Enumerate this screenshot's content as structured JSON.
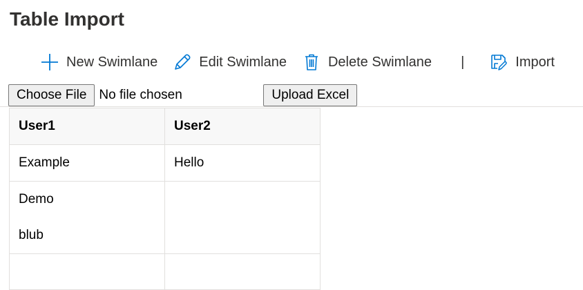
{
  "page": {
    "title": "Table Import"
  },
  "toolbar": {
    "new_label": "New Swimlane",
    "edit_label": "Edit Swimlane",
    "delete_label": "Delete Swimlane",
    "separator": "|",
    "import_label": "Import",
    "icons": [
      "plus-icon",
      "pencil-icon",
      "trash-icon",
      "save-icon"
    ],
    "accent_color": "#0078d4"
  },
  "file_input": {
    "button_label": "Choose File",
    "status": "No file chosen",
    "upload_label": "Upload Excel"
  },
  "table": {
    "headers": [
      "User1",
      "User2"
    ],
    "rows": [
      [
        [
          "Example"
        ],
        [
          "Hello"
        ]
      ],
      [
        [
          "Demo",
          "blub"
        ],
        []
      ],
      [
        [],
        []
      ]
    ]
  }
}
